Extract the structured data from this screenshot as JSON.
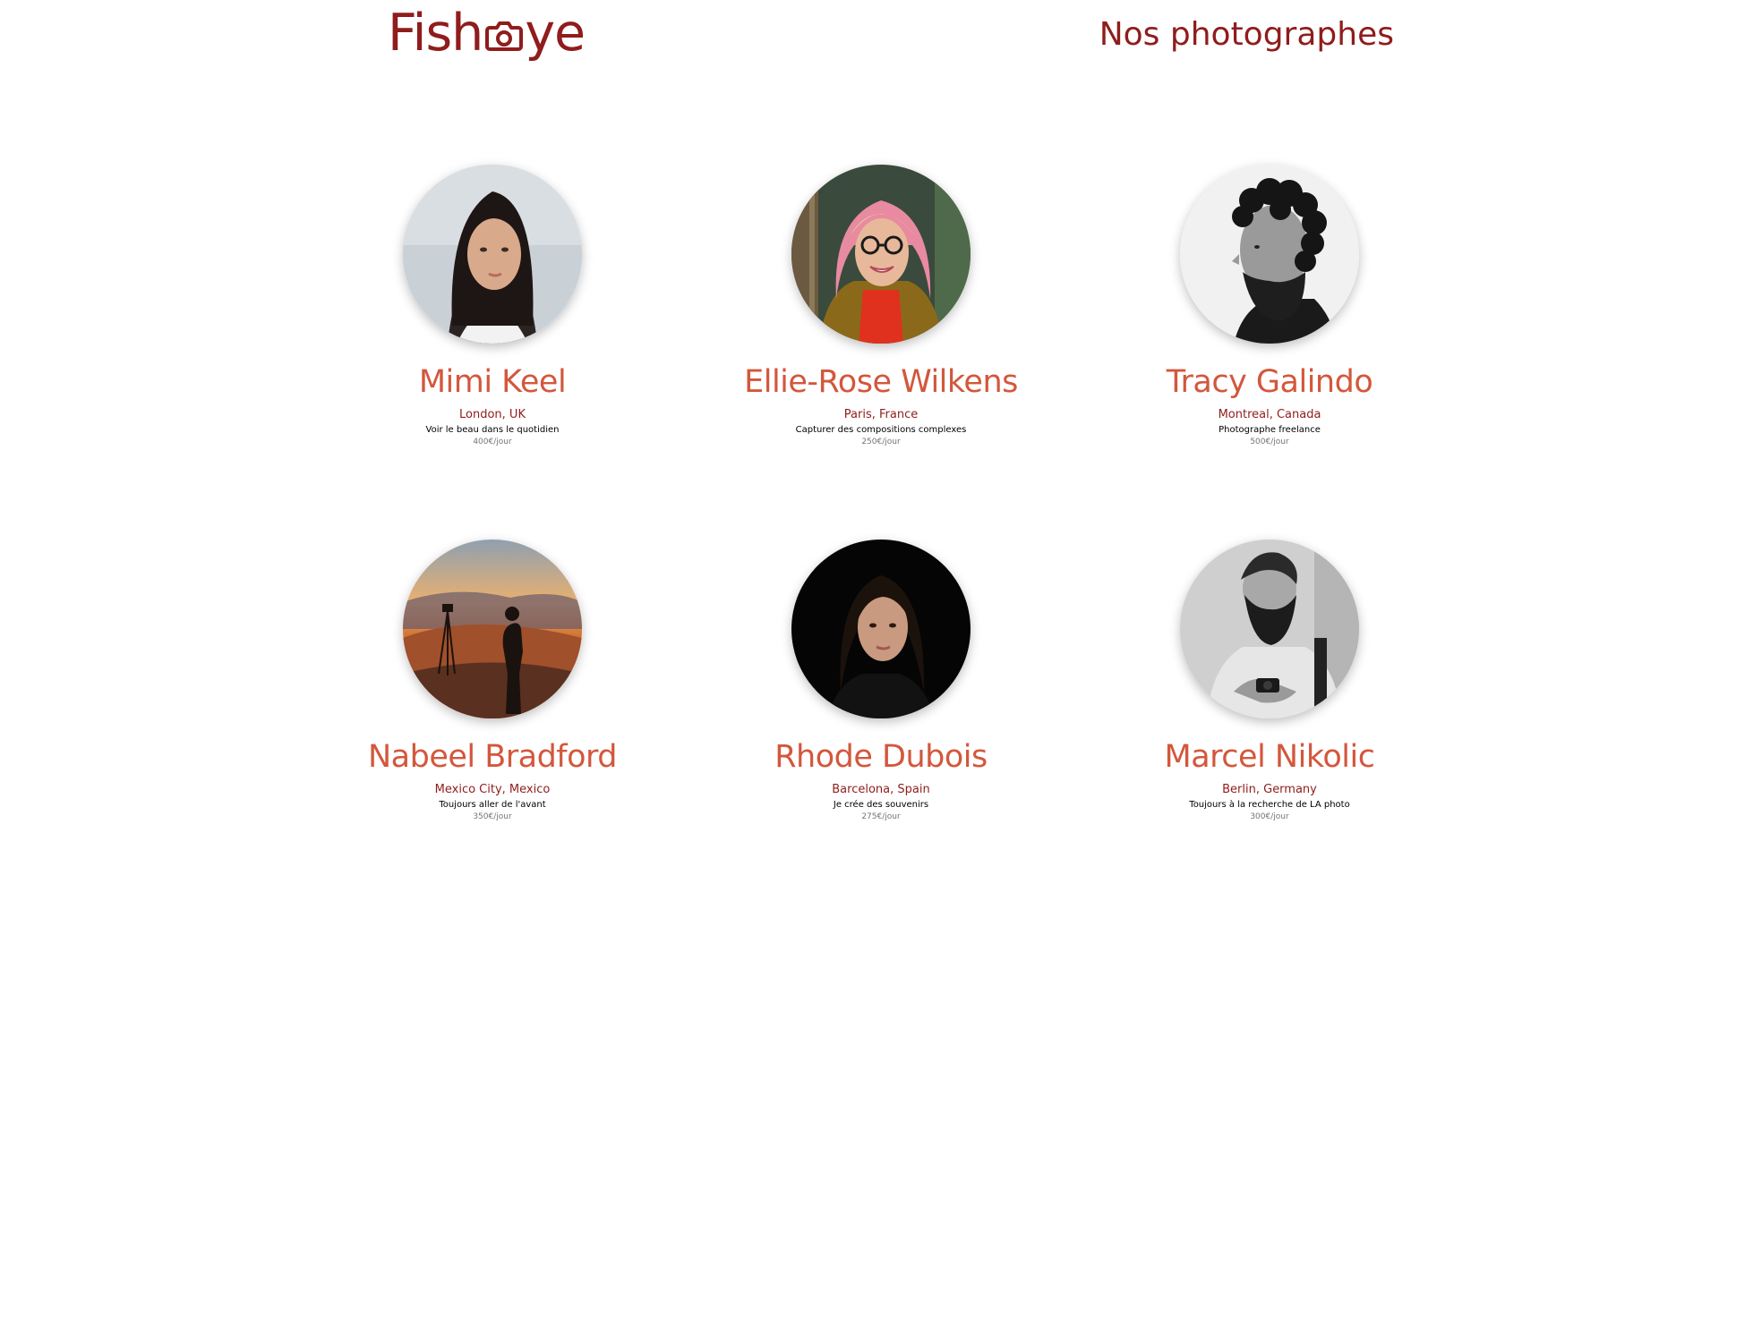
{
  "header": {
    "logo_text_before": "Fish",
    "logo_text_after": "ye",
    "logo_icon": "camera-icon",
    "page_title": "Nos photographes"
  },
  "colors": {
    "primary": "#901C1C",
    "accent": "#D3573C",
    "muted": "#757575",
    "background": "#FFFFFF"
  },
  "photographers": [
    {
      "name": "Mimi Keel",
      "location": "London, UK",
      "tagline": "Voir le beau dans le quotidien",
      "price": "400€/jour",
      "portrait": "portrait-young-woman-dark-hair-photo"
    },
    {
      "name": "Ellie-Rose Wilkens",
      "location": "Paris, France",
      "tagline": "Capturer des compositions complexes",
      "price": "250€/jour",
      "portrait": "portrait-woman-pink-hair-glasses-photo"
    },
    {
      "name": "Tracy Galindo",
      "location": "Montreal, Canada",
      "tagline": "Photographe freelance",
      "price": "500€/jour",
      "portrait": "portrait-bearded-man-curly-hair-bw-photo"
    },
    {
      "name": "Nabeel Bradford",
      "location": "Mexico City, Mexico",
      "tagline": "Toujours aller de l'avant",
      "price": "350€/jour",
      "portrait": "portrait-silhouette-sunset-tripod-photo"
    },
    {
      "name": "Rhode Dubois",
      "location": "Barcelona, Spain",
      "tagline": "Je crée des souvenirs",
      "price": "275€/jour",
      "portrait": "portrait-woman-dark-background-photo"
    },
    {
      "name": "Marcel Nikolic",
      "location": "Berlin, Germany",
      "tagline": "Toujours à la recherche de LA photo",
      "price": "300€/jour",
      "portrait": "portrait-bearded-man-camera-bw-photo"
    }
  ]
}
